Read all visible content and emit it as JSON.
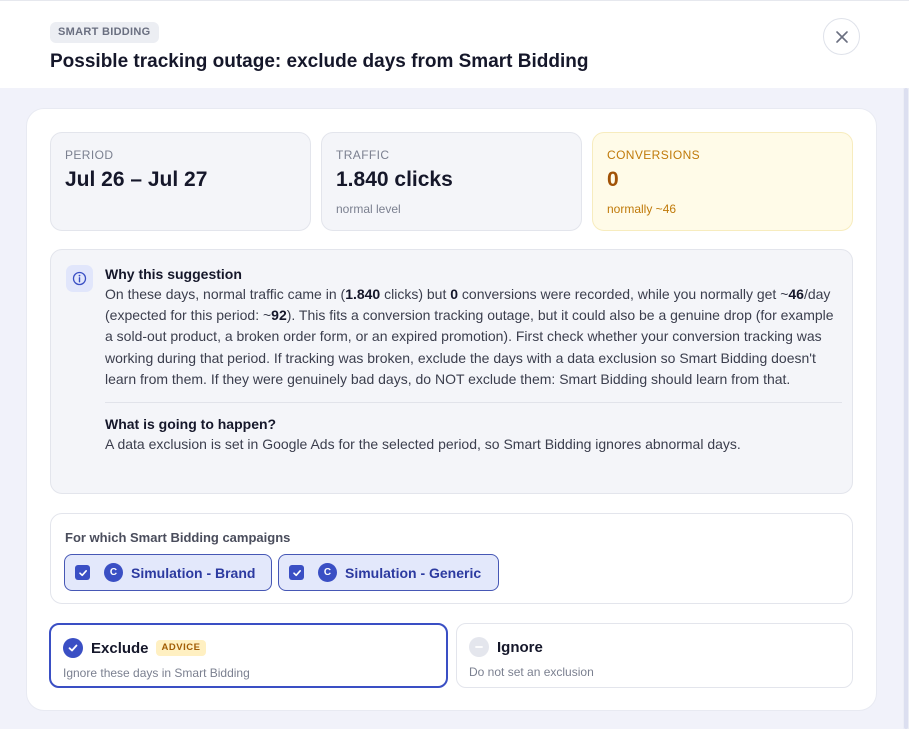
{
  "header": {
    "badge": "SMART BIDDING",
    "title": "Possible tracking outage: exclude days from Smart Bidding",
    "close_icon": "close-icon"
  },
  "stats": [
    {
      "label": "PERIOD",
      "value": "Jul 26 – Jul 27",
      "sub": ""
    },
    {
      "label": "TRAFFIC",
      "value": "1.840 clicks",
      "sub": "normal level"
    },
    {
      "label": "CONVERSIONS",
      "value": "0",
      "sub": "normally ~46"
    }
  ],
  "info": {
    "icon": "info-icon",
    "why_title": "Why this suggestion",
    "why_parts": [
      "On these days, normal traffic came in (",
      "1.840",
      " clicks) but ",
      "0",
      " conversions were recorded, while you normally get ~",
      "46",
      "/day (expected for this period: ~",
      "92",
      "). This fits a conversion tracking outage, but it could also be a genuine drop (for example a sold-out product, a broken order form, or an expired promotion). First check whether your conversion tracking was working during that period. If tracking was broken, exclude the days with a data exclusion so Smart Bidding doesn't learn from them. If they were genuinely bad days, do NOT exclude them: Smart Bidding should learn from that."
    ],
    "happen_title": "What is going to happen?",
    "happen_text": "A data exclusion is set in Google Ads for the selected period, so Smart Bidding ignores abnormal days."
  },
  "campaigns": {
    "label": "For which Smart Bidding campaigns",
    "items": [
      {
        "avatar": "C",
        "name": "Simulation - Brand",
        "checked": true
      },
      {
        "avatar": "C",
        "name": "Simulation - Generic",
        "checked": true
      }
    ]
  },
  "options": {
    "exclude": {
      "title": "Exclude",
      "badge": "ADVICE",
      "sub": "Ignore these days in Smart Bidding",
      "selected": true
    },
    "ignore": {
      "title": "Ignore",
      "sub": "Do not set an exclusion",
      "selected": false
    }
  },
  "colors": {
    "accent": "#3a4fc4",
    "warning_bg": "#fffbe8",
    "warning_text": "#a15206",
    "page_bg": "#f1f2fa"
  }
}
